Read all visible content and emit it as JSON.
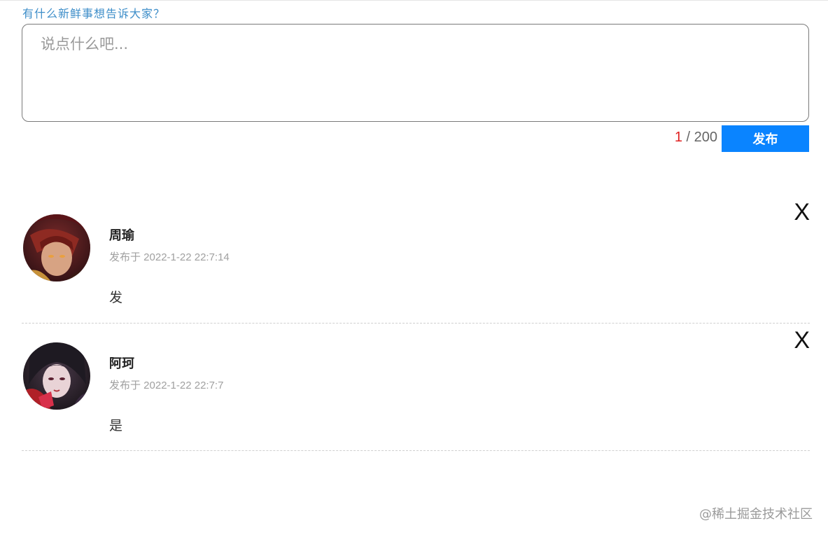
{
  "composer": {
    "prompt": "有什么新鲜事想告诉大家？",
    "placeholder": "说点什么吧...",
    "count_current": "1",
    "count_separator": " / ",
    "count_max": "200",
    "publish_label": "发布"
  },
  "comments": [
    {
      "name": "周瑜",
      "time": "发布于 2022-1-22 22:7:14",
      "content": "发",
      "delete_label": "X",
      "avatar_icon": "avatar-zhouyu-icon"
    },
    {
      "name": "阿珂",
      "time": "发布于 2022-1-22 22:7:7",
      "content": "是",
      "delete_label": "X",
      "avatar_icon": "avatar-ake-icon"
    }
  ],
  "watermark": "@稀土掘金技术社区",
  "colors": {
    "accent": "#0a84ff",
    "prompt": "#3e8ec9",
    "count_current": "#e02020"
  }
}
